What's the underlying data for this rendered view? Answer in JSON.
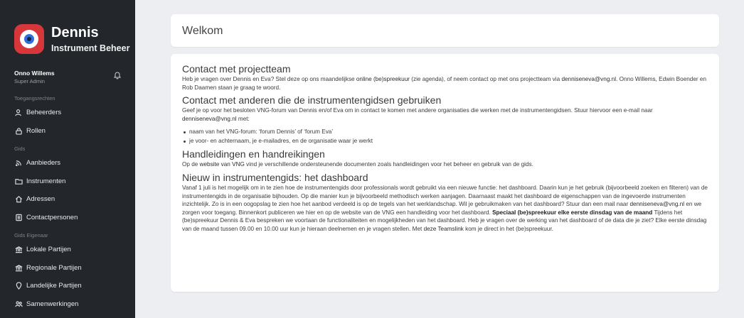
{
  "brand": {
    "name": "Dennis",
    "subtitle": "Instrument Beheer"
  },
  "user": {
    "name": "Onno Willems",
    "role": "Super Admin"
  },
  "sidebar": {
    "sections": [
      {
        "title": "Toegangsrechten",
        "items": [
          {
            "label": "Beheerders",
            "icon": "users-icon"
          },
          {
            "label": "Rollen",
            "icon": "lock-icon"
          }
        ]
      },
      {
        "title": "Gids",
        "items": [
          {
            "label": "Aanbieders",
            "icon": "rss-icon"
          },
          {
            "label": "Instrumenten",
            "icon": "folder-icon"
          },
          {
            "label": "Adressen",
            "icon": "home-icon"
          },
          {
            "label": "Contactpersonen",
            "icon": "address-book-icon"
          }
        ]
      },
      {
        "title": "Gids Eigenaar",
        "items": [
          {
            "label": "Lokale Partijen",
            "icon": "bank-icon"
          },
          {
            "label": "Regionale Partijen",
            "icon": "bank-icon"
          },
          {
            "label": "Landelijke Partijen",
            "icon": "map-pin-icon"
          },
          {
            "label": "Samenwerkingen",
            "icon": "people-icon"
          }
        ]
      }
    ]
  },
  "page": {
    "title": "Welkom"
  },
  "content": {
    "s1": {
      "heading": "Contact met projectteam",
      "t1": "Heb je vragen over Dennis en Eva? Stel deze op ons maandelijkse ",
      "link1": "online (be)spreekuur",
      "t2": " (zie agenda), of neem contact op met ons projectteam via ",
      "link2": "denniseneva@vng.nl",
      "t3": ". Onno Willems, Edwin Boender en Rob Daamen staan je graag te woord."
    },
    "s2": {
      "heading": "Contact met anderen die de instrumentengidsen gebruiken",
      "t1": "Geef je op voor het besloten VNG-forum van Dennis en/of Eva om in contact te komen met andere organisaties die werken met de instrumentengidsen. Stuur hiervoor een e-mail naar ",
      "link1": "denniseneva@vng.nl",
      "t2": " met:",
      "bullets": [
        "naam van het VNG-forum: ‘forum Dennis’ of ‘forum Eva’",
        "je voor- en achternaam, je e-mailadres, en de organisatie waar je werkt"
      ]
    },
    "s3": {
      "heading": "Handleidingen en handreikingen",
      "t1": "Op de ",
      "link1": "website van VNG",
      "t2": " vind je verschillende ondersteunende documenten zoals handleidingen voor het beheer en gebruik van de gids."
    },
    "s4": {
      "heading": "Nieuw in instrumentengids: het dashboard",
      "t1": "Vanaf 1 juli is het mogelijk om in te zien hoe de instrumentengids door professionals wordt gebruikt via een nieuwe functie: het dashboard. Daarin kun je het gebruik (bijvoorbeeld zoeken en filteren) van de instrumentengids in de organisatie bijhouden. Op die manier kun je bijvoorbeeld methodisch werken aanjagen. Daarnaast maakt het dashboard de eigenschappen van de ingevoerde instrumenten inzichtelijk. Zo is in een oogopslag te zien hoe het aanbod verdeeld is op de tegels van het werklandschap. Wil je gebruikmaken van het dashboard? Stuur dan een mail naar ",
      "link1": "denniseneva@vng.nl",
      "t2": " en we zorgen voor toegang. Binnenkort publiceren we hier en op de website van de VNG een handleiding voor het dashboard. ",
      "bold1": "Speciaal (be)spreekuur elke eerste dinsdag van de maand",
      "t3": " Tijdens het (be)spreekuur Dennis & Eva bespreken we voortaan de functionaliteiten en mogelijkheden van het dashboard. Heb je vragen over de werking van het dashboard of de data die je ziet? Elke eerste dinsdag van de maand tussen 09.00 en 10.00 uur kun je hieraan deelnemen en je vragen stellen. Met ",
      "link2": "deze Teamslink",
      "t4": " kom je direct in het (be)spreekuur."
    }
  },
  "colors": {
    "sidebar": "#23262b",
    "background": "#eceef1",
    "brand_red": "#d7373a"
  }
}
